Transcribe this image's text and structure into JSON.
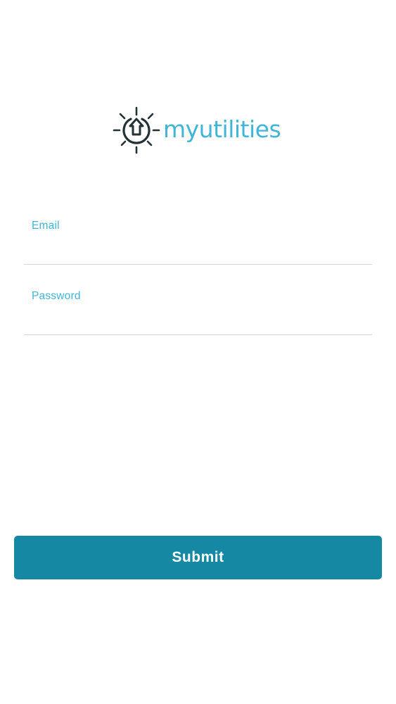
{
  "app": {
    "logo_text": "myutilities",
    "logo_icon": "sun-house-icon"
  },
  "form": {
    "email": {
      "label": "Email",
      "value": ""
    },
    "password": {
      "label": "Password",
      "value": ""
    },
    "submit_label": "Submit"
  },
  "colors": {
    "brand": "#3fb6d8",
    "logo_dark": "#243238",
    "button": "#1588a3",
    "divider": "#d7d7d7"
  }
}
